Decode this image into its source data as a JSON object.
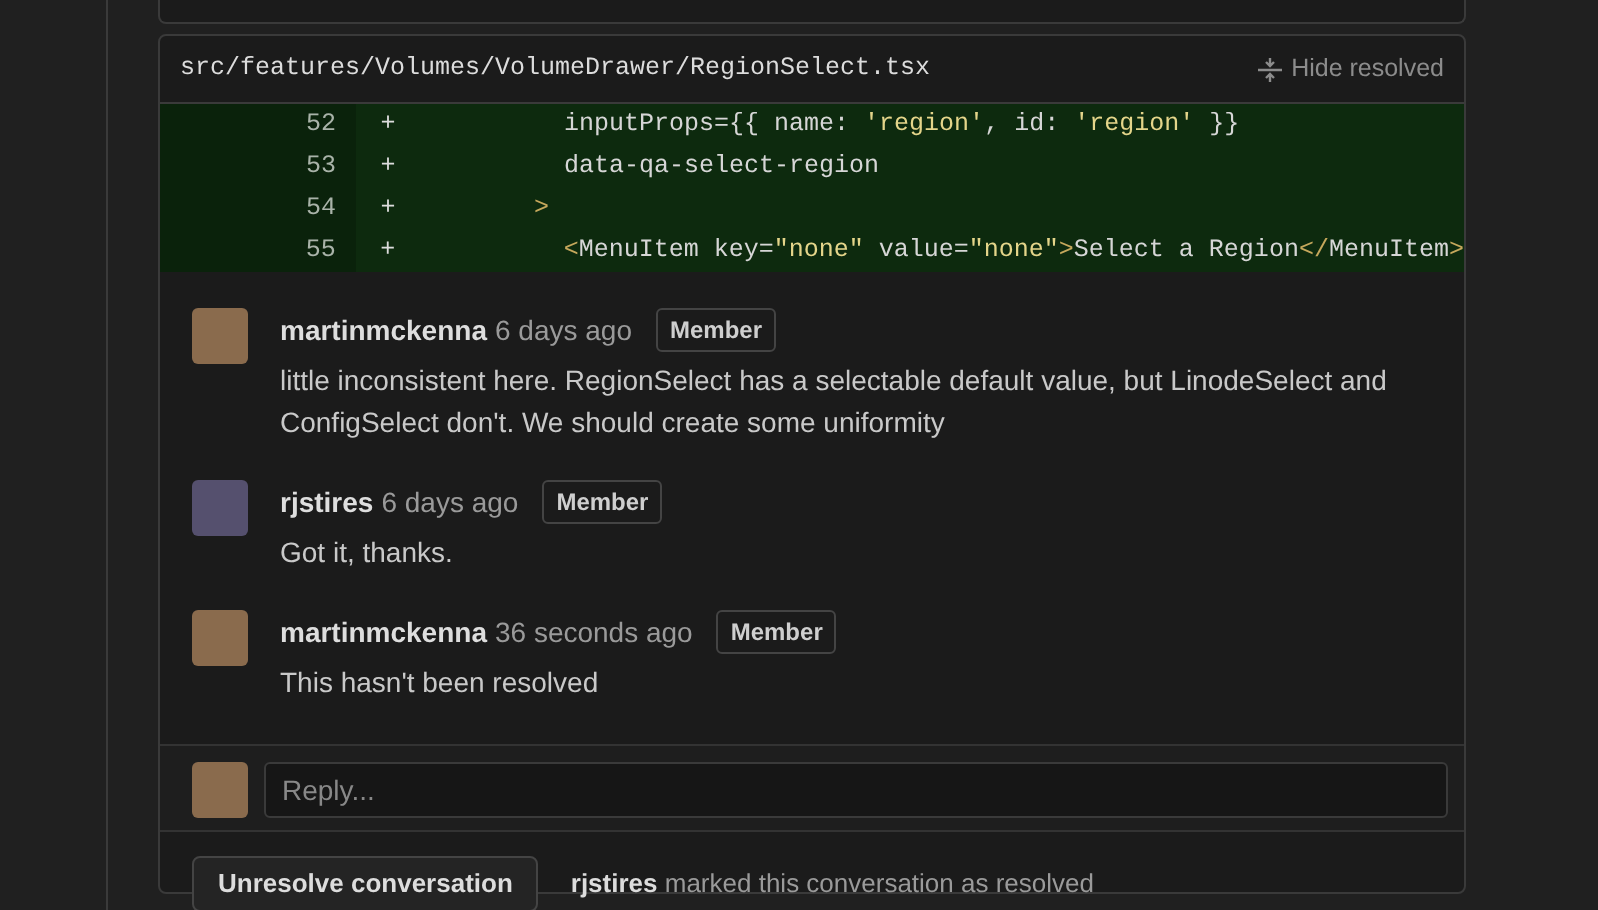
{
  "file": {
    "path": "src/features/Volumes/VolumeDrawer/RegionSelect.tsx",
    "hide_resolved": "Hide resolved"
  },
  "diff": [
    {
      "number": "52",
      "marker": "+",
      "segments": [
        {
          "kind": "plain",
          "text": "          inputProps={{ name: "
        },
        {
          "kind": "string",
          "text": "'region'"
        },
        {
          "kind": "plain",
          "text": ", id: "
        },
        {
          "kind": "string",
          "text": "'region'"
        },
        {
          "kind": "plain",
          "text": " }}"
        }
      ]
    },
    {
      "number": "53",
      "marker": "+",
      "segments": [
        {
          "kind": "plain",
          "text": "          data-qa-select-region"
        }
      ]
    },
    {
      "number": "54",
      "marker": "+",
      "segments": [
        {
          "kind": "tag",
          "text": "        >"
        }
      ]
    },
    {
      "number": "55",
      "marker": "+",
      "segments": [
        {
          "kind": "tag",
          "text": "          <"
        },
        {
          "kind": "plain",
          "text": "MenuItem key="
        },
        {
          "kind": "string",
          "text": "\"none\""
        },
        {
          "kind": "plain",
          "text": " value="
        },
        {
          "kind": "string",
          "text": "\"none\""
        },
        {
          "kind": "tag",
          "text": ">"
        },
        {
          "kind": "plain",
          "text": "Select a Region"
        },
        {
          "kind": "tag",
          "text": "</"
        },
        {
          "kind": "plain",
          "text": "MenuItem"
        },
        {
          "kind": "tag",
          "text": ">"
        }
      ]
    }
  ],
  "comments": [
    {
      "author": "martinmckenna",
      "time": "6 days ago",
      "badge": "Member",
      "body": "little inconsistent here. RegionSelect has a selectable default value, but LinodeSelect and ConfigSelect don't. We should create some uniformity"
    },
    {
      "author": "rjstires",
      "time": "6 days ago",
      "badge": "Member",
      "body": "Got it, thanks."
    },
    {
      "author": "martinmckenna",
      "time": "36 seconds ago",
      "badge": "Member",
      "body": "This hasn't been resolved"
    }
  ],
  "reply": {
    "placeholder": "Reply..."
  },
  "footer": {
    "button": "Unresolve conversation",
    "note": "**rjstires** marked this conversation as resolved"
  }
}
